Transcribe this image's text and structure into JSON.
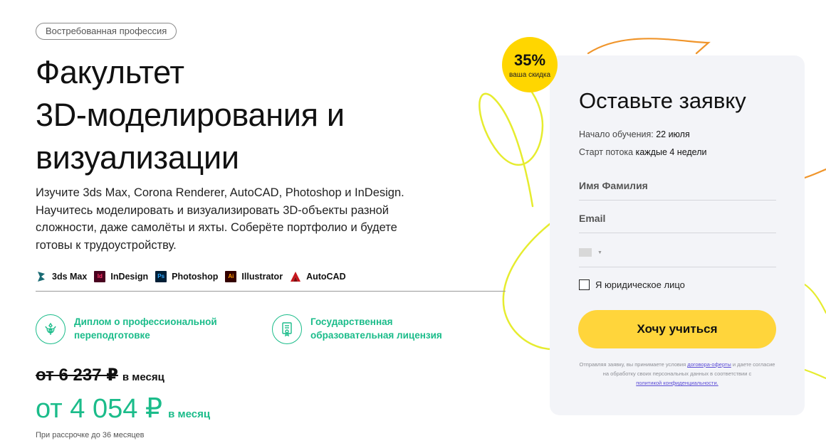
{
  "tag": "Востребованная профессия",
  "title_lines": [
    "Факультет",
    "3D-моделирования и",
    "визуализации"
  ],
  "description": "Изучите 3ds Max, Corona Renderer, AutoCAD, Photoshop и InDesign. Научитесь моделировать и визуализировать 3D-объекты разной сложности, даже самолёты и яхты. Соберёте портфолио и будете готовы к трудоустройству.",
  "tools": [
    {
      "label": "3ds Max",
      "icon": "3ds-max-icon",
      "color": "#1a6b74"
    },
    {
      "label": "InDesign",
      "icon": "indesign-icon",
      "color": "#49021f",
      "abbr": "Id",
      "text_color": "#ff3366"
    },
    {
      "label": "Photoshop",
      "icon": "photoshop-icon",
      "color": "#001e36",
      "abbr": "Ps",
      "text_color": "#31a8ff"
    },
    {
      "label": "Illustrator",
      "icon": "illustrator-icon",
      "color": "#330000",
      "abbr": "Ai",
      "text_color": "#ff9a00"
    },
    {
      "label": "AutoCAD",
      "icon": "autocad-icon",
      "color": "#c7161c"
    }
  ],
  "features": [
    {
      "line1": "Диплом о профессиональной",
      "line2": "переподготовке",
      "icon": "emblem-icon"
    },
    {
      "line1": "Государственная",
      "line2": "образовательная лицензия",
      "icon": "certificate-icon"
    }
  ],
  "price": {
    "old_amount": "от 6 237 ₽",
    "old_unit": "в месяц",
    "new_amount": "от 4 054 ₽",
    "new_unit": "в месяц",
    "installment": "При рассрочке до 36 месяцев"
  },
  "discount": {
    "value": "35%",
    "label": "ваша скидка"
  },
  "form": {
    "title": "Оставьте заявку",
    "start_label": "Начало обучения:",
    "start_value": "22 июля",
    "stream_label": "Старт потока",
    "stream_value": "каждые 4 недели",
    "name_placeholder": "Имя Фамилия",
    "email_placeholder": "Email",
    "legal_entity_label": "Я юридическое лицо",
    "submit_label": "Хочу учиться",
    "legal_before": "Отправляя заявку, вы принимаете условия",
    "legal_link1": "договора-оферты",
    "legal_mid": "и даете согласие на обработку своих персональных данных в соответствии с",
    "legal_link2": "политикой конфиденциальности."
  },
  "colors": {
    "accent_green": "#1bbc8a",
    "badge_yellow": "#ffd600",
    "button_yellow": "#ffd53b",
    "form_bg": "#f3f4f8",
    "doodle_yellow": "#e6ec2f",
    "doodle_orange": "#f0952b"
  }
}
